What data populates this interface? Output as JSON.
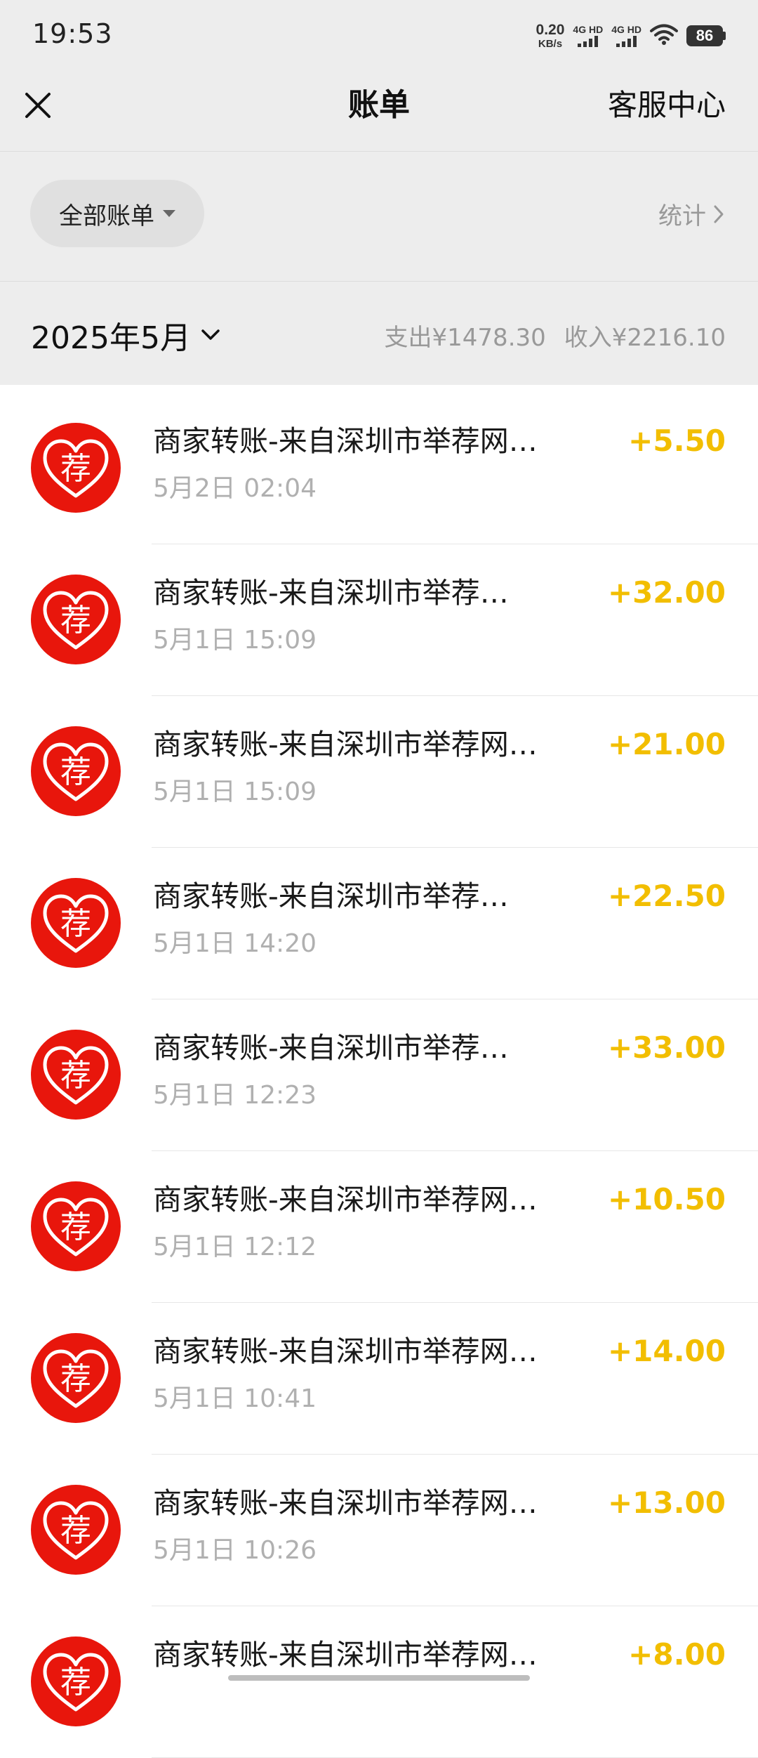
{
  "status_bar": {
    "time": "19:53",
    "net_speed_value": "0.20",
    "net_speed_unit": "KB/s",
    "sim1_label": "4G HD",
    "sim2_label": "4G HD",
    "battery": "86"
  },
  "nav": {
    "title": "账单",
    "right_link": "客服中心",
    "close_icon": "close-icon"
  },
  "filter": {
    "label": "全部账单",
    "stats_label": "统计"
  },
  "month": {
    "label": "2025年5月",
    "expense": "支出¥1478.30",
    "income": "收入¥2216.10"
  },
  "colors": {
    "header_bg": "#ededed",
    "income_amount": "#f2be00",
    "avatar_red": "#e8160c"
  },
  "avatar": {
    "glyph": "荐",
    "icon": "heart-logo-icon"
  },
  "transactions": [
    {
      "title": "商家转账-来自深圳市举荐网…",
      "time": "5月2日 02:04",
      "amount": "+5.50"
    },
    {
      "title": "商家转账-来自深圳市举荐…",
      "time": "5月1日 15:09",
      "amount": "+32.00"
    },
    {
      "title": "商家转账-来自深圳市举荐网…",
      "time": "5月1日 15:09",
      "amount": "+21.00"
    },
    {
      "title": "商家转账-来自深圳市举荐…",
      "time": "5月1日 14:20",
      "amount": "+22.50"
    },
    {
      "title": "商家转账-来自深圳市举荐…",
      "time": "5月1日 12:23",
      "amount": "+33.00"
    },
    {
      "title": "商家转账-来自深圳市举荐网…",
      "time": "5月1日 12:12",
      "amount": "+10.50"
    },
    {
      "title": "商家转账-来自深圳市举荐网…",
      "time": "5月1日 10:41",
      "amount": "+14.00"
    },
    {
      "title": "商家转账-来自深圳市举荐网…",
      "time": "5月1日 10:26",
      "amount": "+13.00"
    },
    {
      "title": "商家转账-来自深圳市举荐网…",
      "time": "",
      "amount": "+8.00"
    }
  ]
}
